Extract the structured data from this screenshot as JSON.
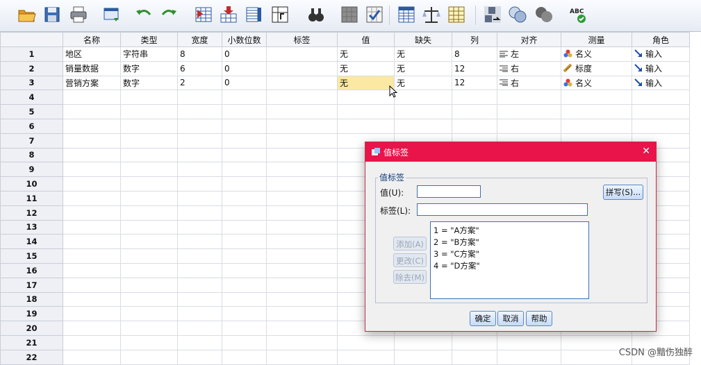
{
  "toolbar": {
    "icons": [
      "open-icon",
      "save-icon",
      "print-icon",
      "dialog-recall-icon",
      "undo-icon",
      "redo-icon",
      "goto-case-icon",
      "goto-variable-icon",
      "variables-icon",
      "find-icon",
      "insert-cases-icon",
      "insert-variable-icon",
      "split-file-icon",
      "weight-cases-icon",
      "select-cases-icon",
      "value-labels-icon",
      "use-sets-icon",
      "show-all-icon",
      "spell-check-icon"
    ],
    "spell_label": "ABC"
  },
  "sheet": {
    "headers": [
      "名称",
      "类型",
      "宽度",
      "小数位数",
      "标签",
      "值",
      "缺失",
      "列",
      "对齐",
      "测量",
      "角色"
    ],
    "rows": [
      {
        "num": "1",
        "name": "地区",
        "type": "字符串",
        "width": "8",
        "decimals": "0",
        "label": "",
        "values": "无",
        "missing": "无",
        "columns": "8",
        "align": "左",
        "measure": "名义",
        "role": "输入"
      },
      {
        "num": "2",
        "name": "销量数据",
        "type": "数字",
        "width": "6",
        "decimals": "0",
        "label": "",
        "values": "无",
        "missing": "无",
        "columns": "12",
        "align": "右",
        "measure": "标度",
        "role": "输入"
      },
      {
        "num": "3",
        "name": "营销方案",
        "type": "数字",
        "width": "2",
        "decimals": "0",
        "label": "",
        "values": "无",
        "missing": "无",
        "columns": "12",
        "align": "右",
        "measure": "名义",
        "role": "输入"
      }
    ],
    "empty_row_numbers": [
      "4",
      "5",
      "6",
      "7",
      "8",
      "9",
      "10",
      "11",
      "12",
      "13",
      "14",
      "15",
      "16",
      "17",
      "18",
      "19",
      "20",
      "21",
      "22"
    ]
  },
  "dialog": {
    "title": "值标签",
    "group_label": "值标签",
    "value_label": "值(U):",
    "label_label": "标签(L):",
    "value_input": "",
    "label_input": "",
    "spelling_button": "拼写(S)...",
    "add_button": "添加(A)",
    "change_button": "更改(C)",
    "remove_button": "除去(M)",
    "list": [
      "1 = \"A方案\"",
      "2 = \"B方案\"",
      "3 = \"C方案\"",
      "4 = \"D方案\""
    ],
    "ok_button": "确定",
    "cancel_button": "取消",
    "help_button": "帮助",
    "close_glyph": "✕"
  },
  "watermark": "CSDN @黯伤独醉",
  "colors": {
    "title_bar": "#e8144a",
    "selected_cell": "#fbe8a3",
    "accent_blue": "#3d6fb6"
  }
}
